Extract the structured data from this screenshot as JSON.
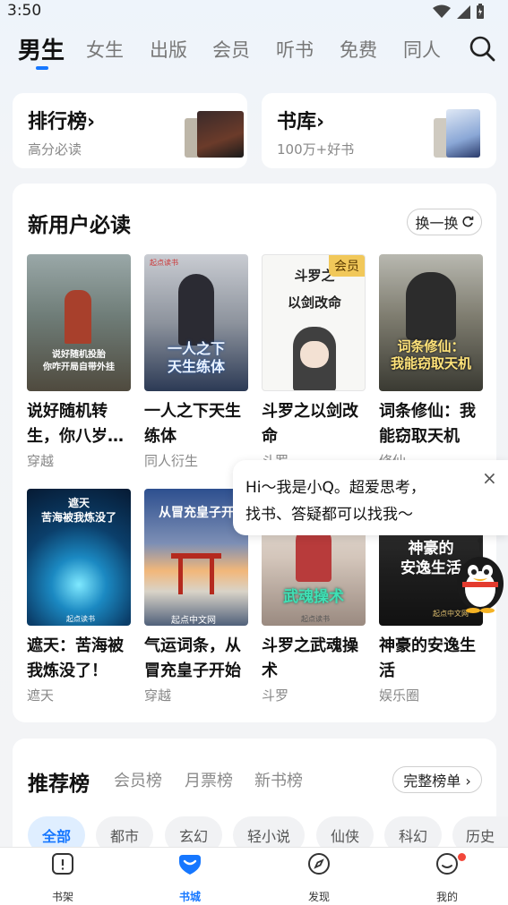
{
  "status_bar": {
    "time": "3:50"
  },
  "top_tabs": [
    {
      "label": "男生",
      "active": true
    },
    {
      "label": "女生"
    },
    {
      "label": "出版"
    },
    {
      "label": "会员"
    },
    {
      "label": "听书"
    },
    {
      "label": "免费"
    },
    {
      "label": "同人"
    }
  ],
  "entries": {
    "ranking": {
      "title": "排行榜",
      "arrow": "›",
      "subtitle": "高分必读"
    },
    "library": {
      "title": "书库",
      "arrow": "›",
      "subtitle": "100万+好书"
    }
  },
  "new_user": {
    "title": "新用户必读",
    "refresh_label": "换一换",
    "books": [
      {
        "title": "说好随机转生，你八岁…",
        "tag": "穿越",
        "cover_text": "说好随机投胎\n你咋开局自带外挂",
        "logo": "起点读书"
      },
      {
        "title": "一人之下天生练体",
        "tag": "同人衍生",
        "cover_text": "一人之下\n天生练体",
        "logo": "起点读书"
      },
      {
        "title": "斗罗之以剑改命",
        "tag": "斗罗",
        "cover_text": "斗罗之\n以剑改命",
        "badge": "会员"
      },
      {
        "title": "词条修仙：我能窃取天机",
        "tag": "修仙",
        "cover_text": "词条修仙：\n我能窃取天机"
      },
      {
        "title": "遮天：苦海被我炼没了！",
        "tag": "遮天",
        "cover_text": "遮天\n苦海被我炼没了",
        "logo": "起点读书"
      },
      {
        "title": "气运词条，从冒充皇子开始",
        "tag": "穿越",
        "cover_text": "从冒充皇子开",
        "logo": "起点中文网"
      },
      {
        "title": "斗罗之武魂操术",
        "tag": "斗罗",
        "cover_text": "武魂操术",
        "logo": "起点读书"
      },
      {
        "title": "神豪的安逸生活",
        "tag": "娱乐圈",
        "cover_text": "神豪的\n安逸生活",
        "logo": "起点中文网"
      }
    ]
  },
  "tooltip": {
    "line1": "Hi～我是小Q。超爱思考，",
    "line2": "找书、答疑都可以找我～",
    "close": "×"
  },
  "ranking": {
    "title": "推荐榜",
    "tabs": [
      "会员榜",
      "月票榜",
      "新书榜"
    ],
    "full_list_label": "完整榜单 ›",
    "chips": [
      {
        "label": "全部",
        "active": true
      },
      {
        "label": "都市"
      },
      {
        "label": "玄幻"
      },
      {
        "label": "轻小说"
      },
      {
        "label": "仙侠"
      },
      {
        "label": "科幻"
      },
      {
        "label": "历史"
      }
    ]
  },
  "bottom_nav": [
    {
      "label": "书架",
      "icon": "bookshelf-icon"
    },
    {
      "label": "书城",
      "icon": "bookstore-icon",
      "active": true
    },
    {
      "label": "发现",
      "icon": "compass-icon"
    },
    {
      "label": "我的",
      "icon": "profile-icon"
    }
  ],
  "colors": {
    "accent": "#1677ff",
    "vip": "#f1c85a",
    "notification": "#f2473a"
  }
}
